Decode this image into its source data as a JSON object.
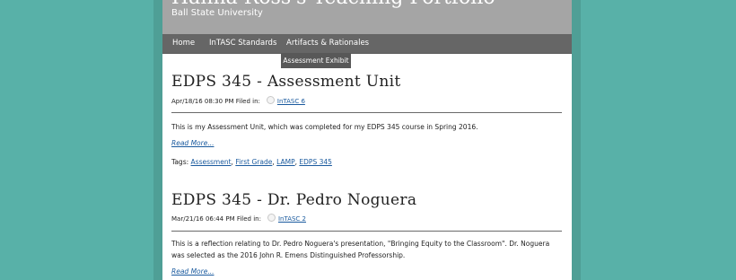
{
  "site": {
    "title": "Hanna Ross's Teaching Portfolio",
    "subtitle": "Ball State University"
  },
  "nav": {
    "items": [
      "Home",
      "InTASC Standards",
      "Artifacts & Rationales"
    ],
    "dropdown_item": "Assessment Exhibit"
  },
  "posts": [
    {
      "title": "EDPS 345 - Assessment Unit",
      "meta_prefix": "Apr/18/16 08:30 PM Filed in:",
      "category": "InTASC 6",
      "body": "This is my Assessment Unit, which was completed for my EDPS 345 course in Spring 2016.",
      "read_more": "Read More...",
      "tags_label": "Tags:",
      "tags": [
        "Assessment",
        "First Grade",
        "LAMP",
        "EDPS 345"
      ]
    },
    {
      "title": "EDPS 345 - Dr. Pedro Noguera",
      "meta_prefix": "Mar/21/16 06:44 PM Filed in:",
      "category": "InTASC 2",
      "body": "This is a reflection relating to Dr. Pedro Noguera's presentation, \"Bringing Equity to the Classroom\". Dr. Noguera was selected as the 2016 John R. Emens Distinguished Professorship.",
      "read_more": "Read More..."
    }
  ]
}
